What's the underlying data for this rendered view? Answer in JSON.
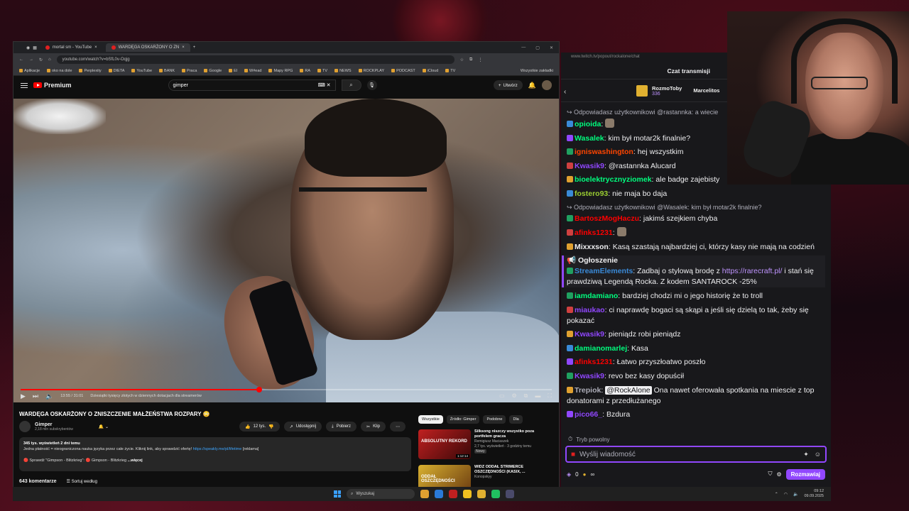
{
  "browser": {
    "tabs": [
      {
        "label": "mortal sm - YouTube",
        "active": false
      },
      {
        "label": "WARDĘGA OSKARŻONY O ZN",
        "active": true
      }
    ],
    "url": "youtube.com/watch?v=bSfL0v-Oqjg",
    "bookmarks": [
      "Aplikacje",
      "oko na dole",
      "Perplexity",
      "DIETA",
      "YouTube",
      "BANK",
      "Praca",
      "Google",
      "El",
      "W#ead",
      "Mapy RPG",
      "RA",
      "TV",
      "NEWS",
      "ROCKPLAY",
      "PODCAST",
      "iCloud",
      "TV"
    ],
    "all_bookmarks": "Wszystkie zakładki"
  },
  "youtube": {
    "logo": "Premium",
    "search_value": "gimper",
    "create_label": "Utwórz",
    "player": {
      "time": "13:55 / 31:01",
      "chapter": "Dziesiątki tysięcy złotych w dziennych dotacjach dla streamerów",
      "progress": 0.4495
    },
    "video_title": "WARDĘGA OSKARŻONY O ZNISZCZENIE MAŁŻEŃSTWA ROZPARY 😳",
    "channel_name": "Gimper",
    "subscribers": "2,18 mln subskrybentów",
    "likes": "12 tys.",
    "share": "Udostępnij",
    "download": "Pobierz",
    "clip": "Klip",
    "description": {
      "stats": "345 tys. wyświetleń  2 dni temu",
      "line1": "Jedna płatność = nieograniczona nauka języka przez całe życie. Kliknij link, aby sprawdzić ofertę!",
      "link": "https://speakly.me/pl/lifetime",
      "ad": "[reklama]",
      "line2a": "🔴 Sprawdź \"Gimpson - Blitzkrieg\":",
      "line2b": "🔴 Gimpson - Blitzkrieg",
      "more": "...więcej"
    },
    "comments_count": "643 komentarze",
    "sort_label": "Sortuj według",
    "chips": [
      "Wszystkie",
      "Źródło: Gimper",
      "Podobne",
      "Dla"
    ],
    "recommendations": [
      {
        "title": "Silksong niszczy wszystko poza portfelem gracza",
        "channel": "Remigiusz Maciaszek",
        "meta": "2,7 tys. wyświetleń · 3 godziny temu",
        "badge": "Nowy",
        "thumb_text": "ABSOLUTNY REKORD",
        "duration": "1:12:14"
      },
      {
        "title": "WIDZ ODDAŁ STRIMERCE OSZCZĘDNOŚCI (KASIX, ...",
        "channel": "Konopskyy",
        "meta": "",
        "badge": "",
        "thumb_text": "ODDAŁ OSZCZĘDNOŚCI",
        "duration": ""
      }
    ]
  },
  "taskbar": {
    "search_placeholder": "Wyszukaj",
    "time": "09:12",
    "date": "09.09.2025"
  },
  "chat": {
    "url": "www.twitch.tv/popout/rockalone/chat",
    "header": "Czat transmisji",
    "pinned_user": "RozmoToby",
    "pinned_count": "336",
    "pinned_user2": "Marcelitos",
    "messages": [
      {
        "type": "reply",
        "text": "Odpowiadasz użytkownikowi @rastannka: a wiecie"
      },
      {
        "user": "opioida",
        "color": "#00ff7f",
        "text": ""
      },
      {
        "user": "Wasalek",
        "color": "#00ff7f",
        "text": "kim był motar2k finalnie?"
      },
      {
        "user": "igniswashington",
        "color": "#ff4500",
        "text": "hej wszystkim"
      },
      {
        "user": "Kwasik9",
        "color": "#9147ff",
        "text": "@rastannka Alucard"
      },
      {
        "user": "bioelektrycznyziomek",
        "color": "#00ff7f",
        "text": "ale badge zajebisty"
      },
      {
        "user": "fostero93",
        "color": "#9acd32",
        "text": "nie maja bo daja"
      },
      {
        "type": "reply",
        "text": "Odpowiadasz użytkownikowi @Wasalek: kim był motar2k finalnie?"
      },
      {
        "user": "BartoszMogHaczu",
        "color": "#ff0000",
        "text": "jakimś szejkiem chyba"
      },
      {
        "user": "afinks1231",
        "color": "#ff0000",
        "text": ""
      },
      {
        "user": "Mixxxson",
        "color": "#efeff1",
        "text": "Kasą szastają najbardziej ci, którzy kasy nie mają na codzień"
      }
    ],
    "announcement": {
      "label": "Ogłoszenie",
      "user": "StreamElements",
      "text1": "Zadbaj o stylową brodę z",
      "link": "https://rarecraft.pl/",
      "text2": "i stań się prawdziwą Legendą Rocka. Z kodem SANTAROCK -25%"
    },
    "messages2": [
      {
        "user": "iamdamiano",
        "color": "#00ff7f",
        "text": "bardziej chodzi mi o jego historię że to troll"
      },
      {
        "user": "miaukao",
        "color": "#9147ff",
        "text": "ci naprawdę bogaci są skąpi a jeśli się dzielą to tak, żeby się pokazać"
      },
      {
        "user": "Kwasik9",
        "color": "#9147ff",
        "text": "pieniądz robi pieniądz"
      },
      {
        "user": "damianomarlej",
        "color": "#00ff7f",
        "text": "Kasa"
      },
      {
        "user": "afinks1231",
        "color": "#ff0000",
        "text": "Łatwo przyszłoatwo poszło"
      },
      {
        "user": "Kwasik9",
        "color": "#9147ff",
        "text": "revo bez kasy dopuścił"
      }
    ],
    "trepiok": {
      "user": "Trepiok",
      "mention": "@RockAlone",
      "text": "Ona nawet oferowała spotkania na miescie z top donatorami z przedłużanego"
    },
    "last": {
      "user": "pico66_",
      "color": "#9147ff",
      "text": "Bzdura"
    },
    "slow_mode": "Tryb powolny",
    "input_placeholder": "Wyślij wiadomość",
    "points": "0",
    "chat_button": "Rozmawiaj"
  }
}
